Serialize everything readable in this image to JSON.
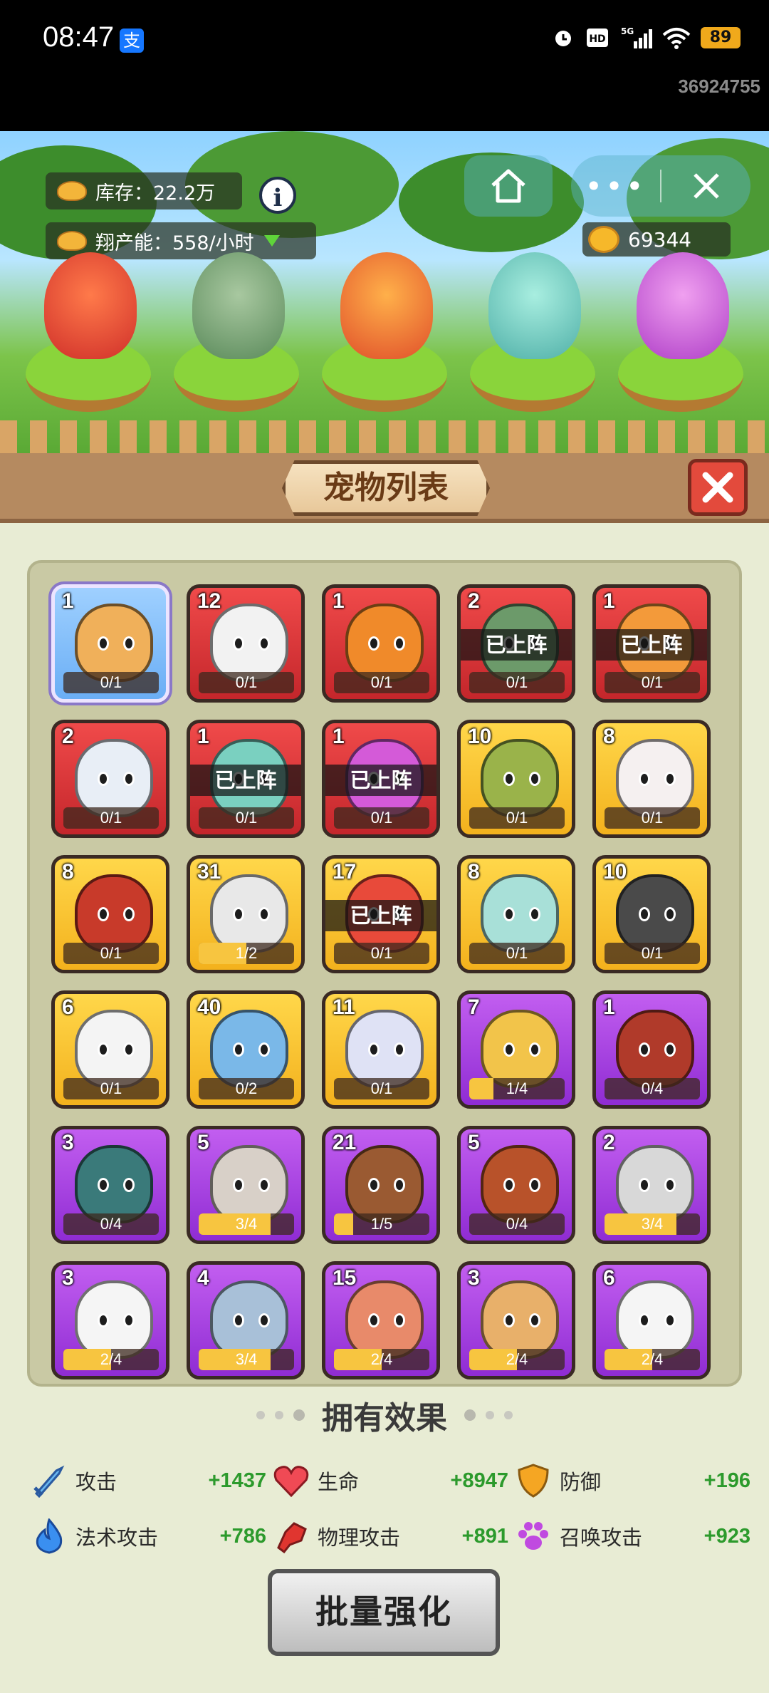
{
  "status_bar": {
    "time": "08:47",
    "app_badge_icon": "alipay-icon",
    "network": "5G",
    "hd_label": "HD",
    "battery": "89",
    "user_id": "36924755"
  },
  "scene": {
    "stock_label": "库存：22.2万",
    "production_label": "翔产能：558/小时",
    "info_symbol": "i",
    "gold_amount": "69344",
    "more_symbol": "•••",
    "stage_pets": [
      "goldfish",
      "dragon-turtle",
      "phoenix",
      "azure-dragon",
      "butterfly"
    ]
  },
  "panel": {
    "title": "宠物列表",
    "deployed_label": "已上阵",
    "cards": [
      {
        "level": "1",
        "count": "0/1",
        "progress": 0,
        "rarity": "blue",
        "deployed": false,
        "pet": "lion",
        "hue": "#f0b05a"
      },
      {
        "level": "12",
        "count": "0/1",
        "progress": 0,
        "rarity": "red",
        "deployed": false,
        "pet": "eagle",
        "hue": "#f2f2f2"
      },
      {
        "level": "1",
        "count": "0/1",
        "progress": 0,
        "rarity": "red",
        "deployed": false,
        "pet": "triceratops",
        "hue": "#f08a2a"
      },
      {
        "level": "2",
        "count": "0/1",
        "progress": 0,
        "rarity": "red",
        "deployed": true,
        "pet": "dragon-turtle",
        "hue": "#6c9a6a"
      },
      {
        "level": "1",
        "count": "0/1",
        "progress": 0,
        "rarity": "red",
        "deployed": true,
        "pet": "phoenix",
        "hue": "#f39a3a"
      },
      {
        "level": "2",
        "count": "0/1",
        "progress": 0,
        "rarity": "red",
        "deployed": false,
        "pet": "white-tiger",
        "hue": "#e8eef6"
      },
      {
        "level": "1",
        "count": "0/1",
        "progress": 0,
        "rarity": "red",
        "deployed": true,
        "pet": "azure-dragon",
        "hue": "#7ad0c0"
      },
      {
        "level": "1",
        "count": "0/1",
        "progress": 0,
        "rarity": "red",
        "deployed": true,
        "pet": "butterfly",
        "hue": "#d45ad8"
      },
      {
        "level": "10",
        "count": "0/1",
        "progress": 0,
        "rarity": "gold",
        "deployed": false,
        "pet": "frog",
        "hue": "#9ab34a"
      },
      {
        "level": "8",
        "count": "0/1",
        "progress": 0,
        "rarity": "gold",
        "deployed": false,
        "pet": "fox",
        "hue": "#f5f0f0"
      },
      {
        "level": "8",
        "count": "0/1",
        "progress": 0,
        "rarity": "gold",
        "deployed": false,
        "pet": "red-horse",
        "hue": "#c83a2a"
      },
      {
        "level": "31",
        "count": "1/2",
        "progress": 0.5,
        "rarity": "gold",
        "deployed": false,
        "pet": "lion-dance",
        "hue": "#e8e8e8"
      },
      {
        "level": "17",
        "count": "0/1",
        "progress": 0,
        "rarity": "gold",
        "deployed": true,
        "pet": "goldfish",
        "hue": "#e84a3a"
      },
      {
        "level": "8",
        "count": "0/1",
        "progress": 0,
        "rarity": "gold",
        "deployed": false,
        "pet": "deer",
        "hue": "#a8e0d8"
      },
      {
        "level": "10",
        "count": "0/1",
        "progress": 0,
        "rarity": "gold",
        "deployed": false,
        "pet": "gorilla",
        "hue": "#4a4a4a"
      },
      {
        "level": "6",
        "count": "0/1",
        "progress": 0,
        "rarity": "gold",
        "deployed": false,
        "pet": "panda",
        "hue": "#f4f4f4"
      },
      {
        "level": "40",
        "count": "0/2",
        "progress": 0,
        "rarity": "gold",
        "deployed": false,
        "pet": "elephant",
        "hue": "#7ab8e8"
      },
      {
        "level": "11",
        "count": "0/1",
        "progress": 0,
        "rarity": "gold",
        "deployed": false,
        "pet": "unicorn",
        "hue": "#dfe2f5"
      },
      {
        "level": "7",
        "count": "1/4",
        "progress": 0.25,
        "rarity": "purple",
        "deployed": false,
        "pet": "leopard",
        "hue": "#f2c44a"
      },
      {
        "level": "1",
        "count": "0/4",
        "progress": 0,
        "rarity": "purple",
        "deployed": false,
        "pet": "rooster",
        "hue": "#b03a2a"
      },
      {
        "level": "3",
        "count": "0/4",
        "progress": 0,
        "rarity": "purple",
        "deployed": false,
        "pet": "crocodile",
        "hue": "#3a7a7a"
      },
      {
        "level": "5",
        "count": "3/4",
        "progress": 0.75,
        "rarity": "purple",
        "deployed": false,
        "pet": "cat",
        "hue": "#d8d0c8"
      },
      {
        "level": "21",
        "count": "1/5",
        "progress": 0.2,
        "rarity": "purple",
        "deployed": false,
        "pet": "bear",
        "hue": "#9a5a32"
      },
      {
        "level": "5",
        "count": "0/4",
        "progress": 0,
        "rarity": "purple",
        "deployed": false,
        "pet": "red-panda",
        "hue": "#b8522a"
      },
      {
        "level": "2",
        "count": "3/4",
        "progress": 0.75,
        "rarity": "purple",
        "deployed": false,
        "pet": "raccoon",
        "hue": "#d8d8d8"
      },
      {
        "level": "3",
        "count": "2/4",
        "progress": 0.5,
        "rarity": "purple",
        "deployed": false,
        "pet": "bald-eagle",
        "hue": "#f5f5f5"
      },
      {
        "level": "4",
        "count": "3/4",
        "progress": 0.75,
        "rarity": "purple",
        "deployed": false,
        "pet": "wolf",
        "hue": "#a8c0d8"
      },
      {
        "level": "15",
        "count": "2/4",
        "progress": 0.5,
        "rarity": "purple",
        "deployed": false,
        "pet": "octopus",
        "hue": "#e88a6a"
      },
      {
        "level": "3",
        "count": "2/4",
        "progress": 0.5,
        "rarity": "purple",
        "deployed": false,
        "pet": "shiba",
        "hue": "#e8b06a"
      },
      {
        "level": "6",
        "count": "2/4",
        "progress": 0.5,
        "rarity": "purple",
        "deployed": false,
        "pet": "rabbit",
        "hue": "#f5f5f5"
      }
    ]
  },
  "effects": {
    "title": "拥有效果",
    "stats": [
      {
        "icon": "sword-icon",
        "label": "攻击",
        "value": "+1437"
      },
      {
        "icon": "heart-icon",
        "label": "生命",
        "value": "+8947"
      },
      {
        "icon": "shield-icon",
        "label": "防御",
        "value": "+196"
      },
      {
        "icon": "flame-icon",
        "label": "法术攻击",
        "value": "+786"
      },
      {
        "icon": "fist-icon",
        "label": "物理攻击",
        "value": "+891"
      },
      {
        "icon": "paw-icon",
        "label": "召唤攻击",
        "value": "+923"
      }
    ]
  },
  "actions": {
    "batch_upgrade": "批量强化"
  },
  "colors": {
    "value_green": "#2c9a2c",
    "panel_bg": "#e8ecd4",
    "red_card": "#d8333a",
    "gold_card": "#f7c230",
    "purple_card": "#a540e0"
  }
}
